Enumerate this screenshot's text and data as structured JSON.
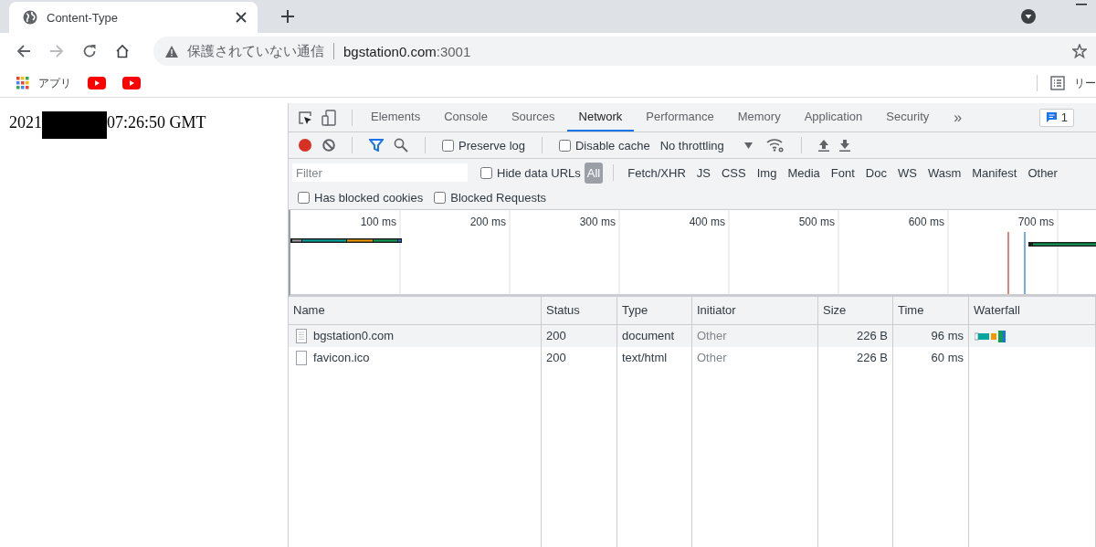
{
  "browser": {
    "tab": {
      "title": "Content-Type"
    },
    "address": {
      "security_label": "保護されていない通信",
      "host": "bgstation0.com",
      "port": ":3001"
    },
    "bookmarks": [
      {
        "kind": "apps",
        "label": "アプリ"
      },
      {
        "kind": "youtube"
      },
      {
        "kind": "youtube"
      }
    ],
    "reading_list": "リー"
  },
  "page": {
    "date_prefix": "2021",
    "time_suffix": "07:26:50 GMT"
  },
  "devtools": {
    "tabs": [
      {
        "label": "Elements",
        "selected": false
      },
      {
        "label": "Console",
        "selected": false
      },
      {
        "label": "Sources",
        "selected": false
      },
      {
        "label": "Network",
        "selected": true
      },
      {
        "label": "Performance",
        "selected": false
      },
      {
        "label": "Memory",
        "selected": false
      },
      {
        "label": "Application",
        "selected": false
      },
      {
        "label": "Security",
        "selected": false
      }
    ],
    "more_tabs": "»",
    "issues_count": "1",
    "toolbar": {
      "recording": true,
      "preserve_log": {
        "label": "Preserve log",
        "checked": false
      },
      "disable_cache": {
        "label": "Disable cache",
        "checked": false
      },
      "throttling": "No throttling"
    },
    "filter": {
      "placeholder": "Filter"
    },
    "hide_data_urls": {
      "label": "Hide data URLs",
      "checked": false
    },
    "types": [
      {
        "label": "All",
        "selected": true
      },
      {
        "label": "Fetch/XHR",
        "selected": false
      },
      {
        "label": "JS",
        "selected": false
      },
      {
        "label": "CSS",
        "selected": false
      },
      {
        "label": "Img",
        "selected": false
      },
      {
        "label": "Media",
        "selected": false
      },
      {
        "label": "Font",
        "selected": false
      },
      {
        "label": "Doc",
        "selected": false
      },
      {
        "label": "WS",
        "selected": false
      },
      {
        "label": "Wasm",
        "selected": false
      },
      {
        "label": "Manifest",
        "selected": false
      },
      {
        "label": "Other",
        "selected": false
      }
    ],
    "has_blocked_cookies": {
      "label": "Has blocked cookies",
      "checked": false
    },
    "blocked_requests": {
      "label": "Blocked Requests",
      "checked": false
    },
    "overview": {
      "ticks": [
        "100 ms",
        "200 ms",
        "300 ms",
        "400 ms",
        "500 ms",
        "600 ms",
        "700 ms"
      ]
    },
    "table": {
      "columns": [
        "Name",
        "Status",
        "Type",
        "Initiator",
        "Size",
        "Time",
        "Waterfall"
      ],
      "rows": [
        {
          "name": "bgstation0.com",
          "status": "200",
          "type": "document",
          "initiator": "Other",
          "size": "226 B",
          "time": "96 ms",
          "waterfall_bar": true,
          "selected": true
        },
        {
          "name": "favicon.ico",
          "status": "200",
          "type": "text/html",
          "initiator": "Other",
          "size": "226 B",
          "time": "60 ms",
          "waterfall_bar": false,
          "selected": false
        }
      ]
    }
  }
}
